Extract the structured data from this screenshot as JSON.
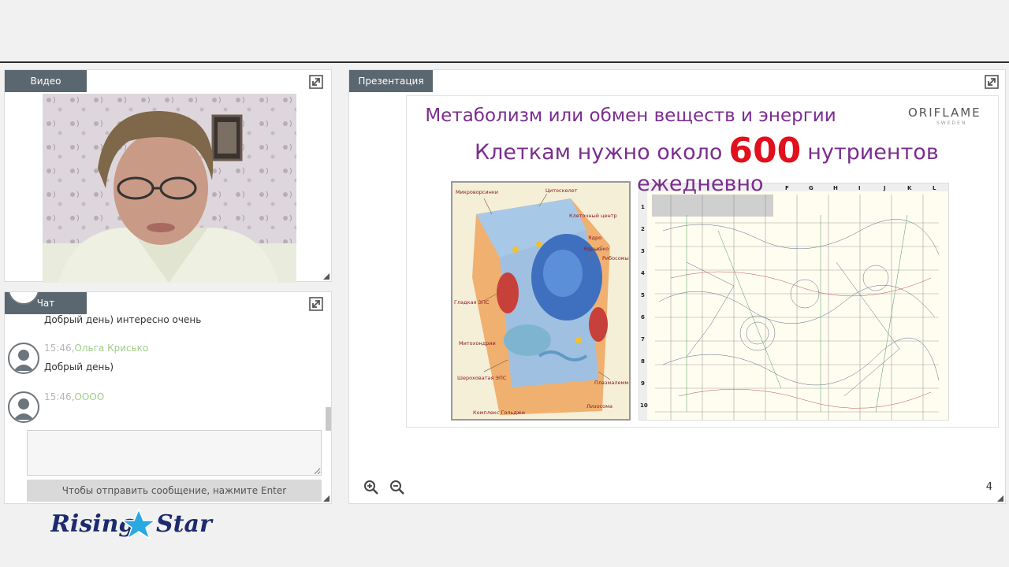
{
  "video_panel": {
    "tab_label": "Видео"
  },
  "chat_panel": {
    "tab_label": "Чат",
    "messages": [
      {
        "time": "",
        "author": "",
        "text": "Добрый день) интересно очень"
      },
      {
        "time": "15:46,",
        "author": "Ольга Крисько",
        "text": "Добрый день)"
      },
      {
        "time": "15:46,",
        "author": "ОООО",
        "text": ""
      }
    ],
    "send_hint": "Чтобы отправить сообщение, нажмите Enter"
  },
  "presentation_panel": {
    "tab_label": "Презентация",
    "slide": {
      "title": "Метаболизм или обмен веществ и энергии",
      "heading_before": "Клеткам нужно около",
      "heading_number": "600",
      "heading_after": "нутриентов",
      "heading_line2": "ежедневно",
      "logo": "ORIFLAME",
      "logo_sub": "SWEDEN",
      "cell_labels": [
        "Микроворсинки",
        "Цитоскелет",
        "Клеточный центр",
        "Ядро",
        "Ядрышко",
        "Рибосомы",
        "Гладкая ЭПС",
        "Митохондрии",
        "Шероховатая ЭПС",
        "Плазмалемма",
        "Лизосома",
        "Комплекс Гольджи"
      ],
      "grid_cols": [
        "F",
        "G",
        "H",
        "I",
        "J",
        "K",
        "L"
      ],
      "grid_rows": [
        "1",
        "2",
        "3",
        "4",
        "5",
        "6",
        "7",
        "8",
        "9",
        "10"
      ]
    },
    "page_number": "4"
  },
  "brand": {
    "text_left": "Rising",
    "text_right": "Star"
  },
  "colors": {
    "tab_bg": "#5b6770",
    "chat_author": "#9ccc88",
    "slide_title": "#7a2e8e",
    "slide_number": "#e0101c"
  }
}
